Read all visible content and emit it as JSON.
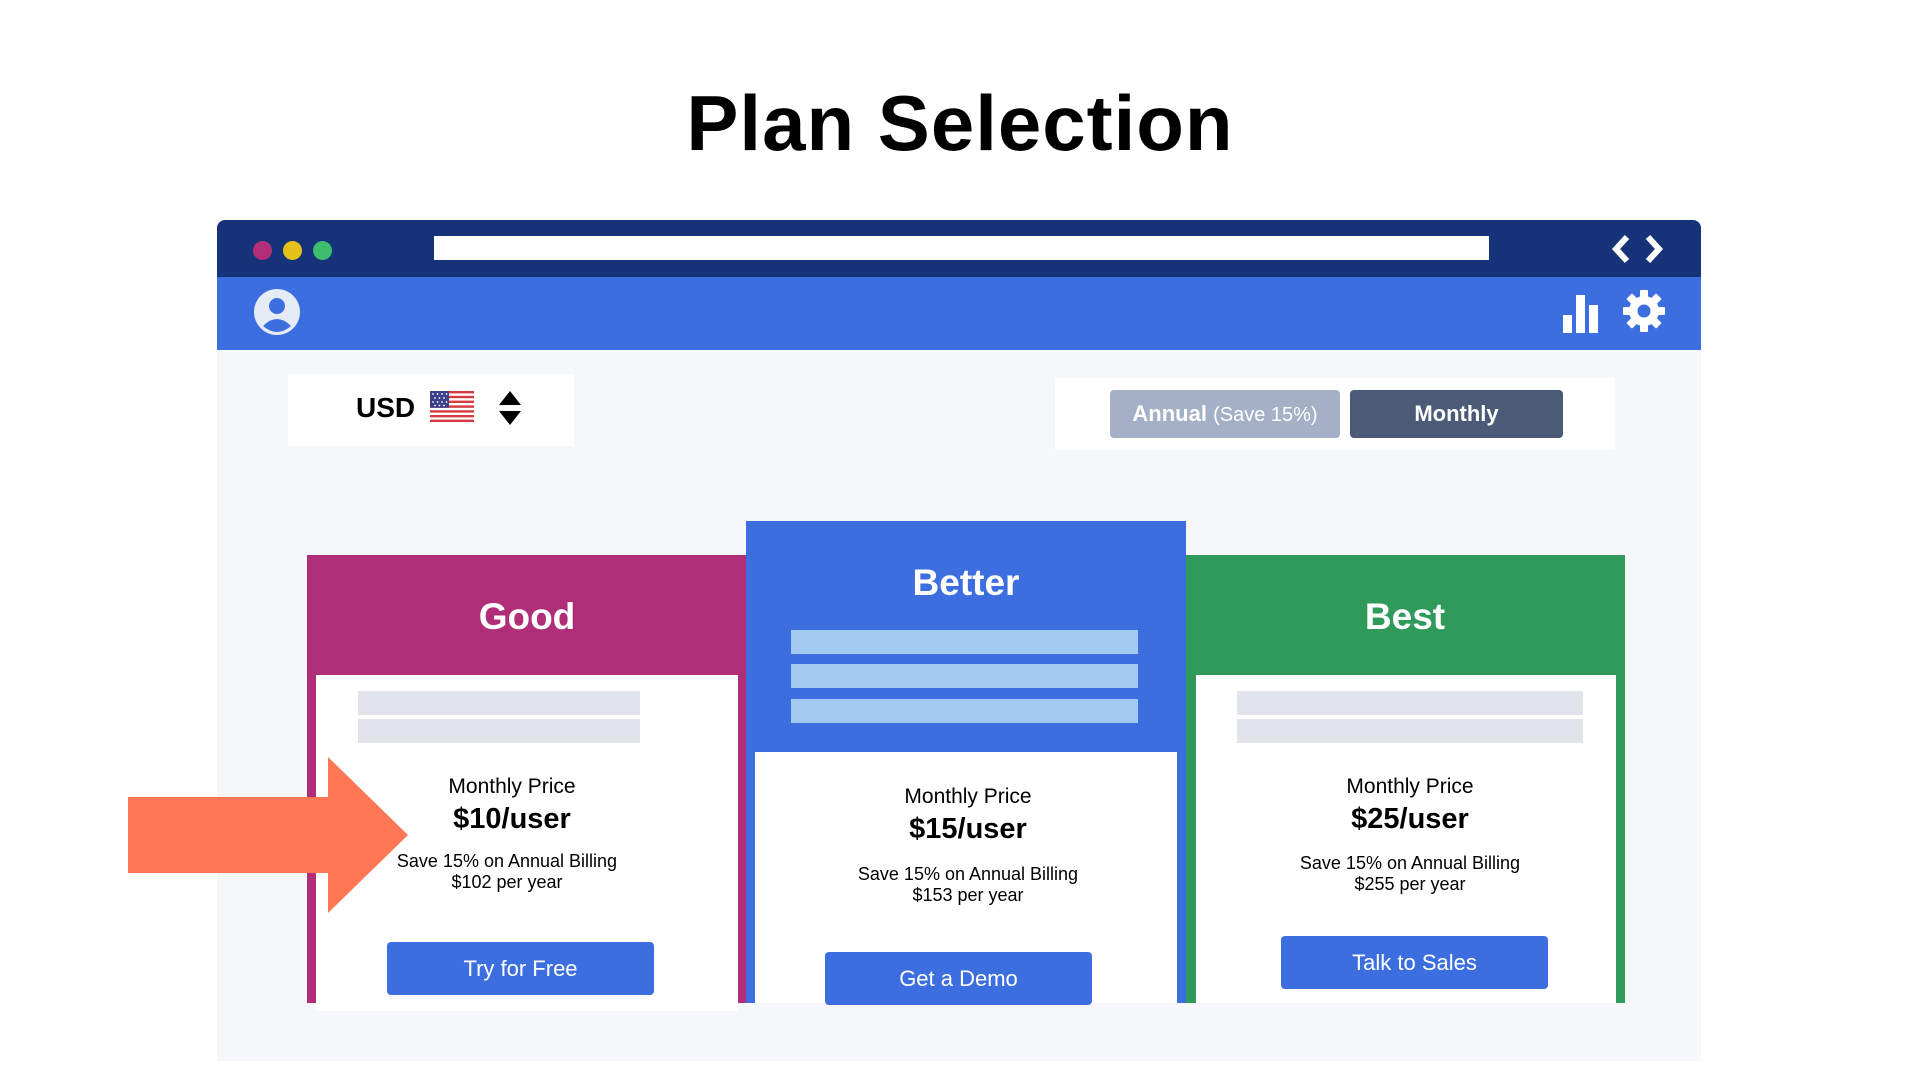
{
  "page": {
    "title": "Plan Selection"
  },
  "window": {
    "controls": [
      "close-dot",
      "minimize-dot",
      "maximize-dot"
    ],
    "icons": {
      "back": "chevron-left-icon",
      "forward": "chevron-right-icon",
      "user": "user-avatar-icon",
      "analytics": "bar-chart-icon",
      "settings": "gear-icon"
    }
  },
  "currency": {
    "code": "USD",
    "flag": "us-flag-icon",
    "toggle_icon": "sort-up-down-icon"
  },
  "billing": {
    "annual_label": "Annual",
    "annual_note": "(Save 15%)",
    "monthly_label": "Monthly",
    "selected": "Monthly"
  },
  "plans": [
    {
      "name": "Good",
      "price_label": "Monthly Price",
      "price": "$10/user",
      "save_note": "Save 15% on Annual Billing",
      "annual_price": "$102 per year",
      "cta": "Try for Free",
      "color": "#b02e78"
    },
    {
      "name": "Better",
      "price_label": "Monthly Price",
      "price": "$15/user",
      "save_note": "Save 15% on Annual Billing",
      "annual_price": "$153 per year",
      "cta": "Get a Demo",
      "color": "#3d6ee0"
    },
    {
      "name": "Best",
      "price_label": "Monthly Price",
      "price": "$25/user",
      "save_note": "Save 15% on Annual Billing",
      "annual_price": "$255 per year",
      "cta": "Talk to Sales",
      "color": "#2f9a5a"
    }
  ],
  "colors": {
    "titlebar": "#163278",
    "toolbar": "#3d6ee0",
    "arrow": "#ff7755",
    "accent": "#3d6ee0"
  }
}
